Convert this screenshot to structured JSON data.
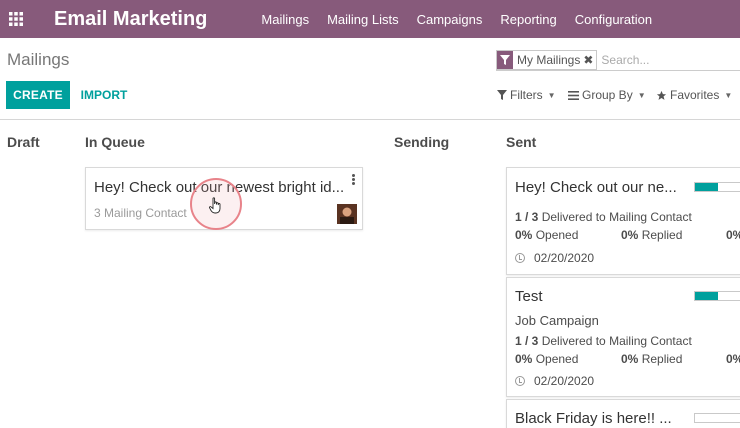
{
  "navbar": {
    "app_title": "Email Marketing",
    "menu": [
      "Mailings",
      "Mailing Lists",
      "Campaigns",
      "Reporting",
      "Configuration"
    ]
  },
  "control_panel": {
    "breadcrumb": "Mailings",
    "create_label": "CREATE",
    "import_label": "IMPORT",
    "search": {
      "facet_label": "My Mailings",
      "placeholder": "Search..."
    },
    "filters_label": "Filters",
    "group_by_label": "Group By",
    "favorites_label": "Favorites"
  },
  "kanban": {
    "columns": [
      "Draft",
      "In Queue",
      "Sending",
      "Sent"
    ],
    "queue_card": {
      "title": "Hey! Check out our newest bright id...",
      "recipients": "3 Mailing Contact"
    },
    "sent_cards": [
      {
        "title": "Hey! Check out our ne...",
        "progress_fraction": 0.5,
        "delivered_count": "1 / 3",
        "delivered_text": "Delivered to Mailing Contact",
        "opened_pct": "0%",
        "opened_label": "Opened",
        "replied_pct": "0%",
        "replied_label": "Replied",
        "third_pct": "0%",
        "date": "02/20/2020"
      },
      {
        "title": "Test",
        "campaign": "Job Campaign",
        "progress_fraction": 0.5,
        "delivered_count": "1 / 3",
        "delivered_text": "Delivered to Mailing Contact",
        "opened_pct": "0%",
        "opened_label": "Opened",
        "replied_pct": "0%",
        "replied_label": "Replied",
        "third_pct": "0%",
        "date": "02/20/2020"
      },
      {
        "title": "Black Friday is here!! ...",
        "progress_fraction": 0
      }
    ]
  },
  "colors": {
    "navbar": "#875a7b",
    "accent": "#00a09d"
  }
}
